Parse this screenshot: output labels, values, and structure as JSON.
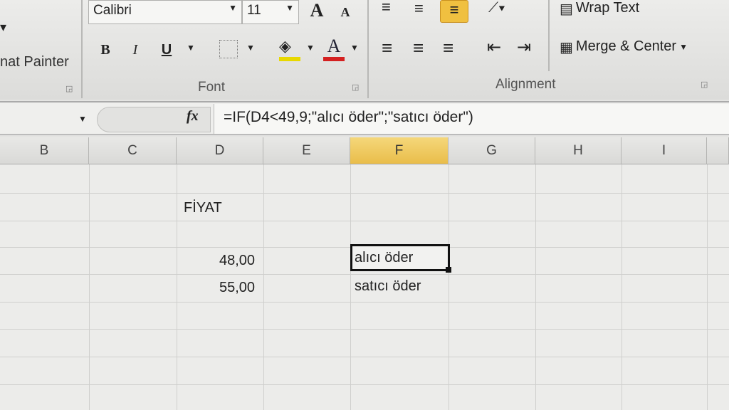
{
  "ribbon": {
    "clipboard": {
      "format_painter": "nat Painter"
    },
    "font": {
      "name": "Calibri",
      "size": "11",
      "group_label": "Font",
      "bold": "B",
      "italic": "I",
      "underline": "U",
      "grow": "A",
      "shrink": "A",
      "font_color_letter": "A",
      "fill_color": "#e8d800",
      "font_color": "#d42020"
    },
    "alignment": {
      "wrap_text": "Wrap Text",
      "merge_center": "Merge & Center",
      "group_label": "Alignment"
    }
  },
  "formula_bar": {
    "fx": "fx",
    "formula": "=IF(D4<49,9;\"alıcı öder\";\"satıcı öder\")"
  },
  "columns": [
    "B",
    "C",
    "D",
    "E",
    "F",
    "G",
    "H",
    "I"
  ],
  "selected_column": "F",
  "cells": {
    "d2": "FİYAT",
    "d4": "48,00",
    "d5": "55,00",
    "f4": "alıcı öder",
    "f5": "satıcı öder"
  }
}
